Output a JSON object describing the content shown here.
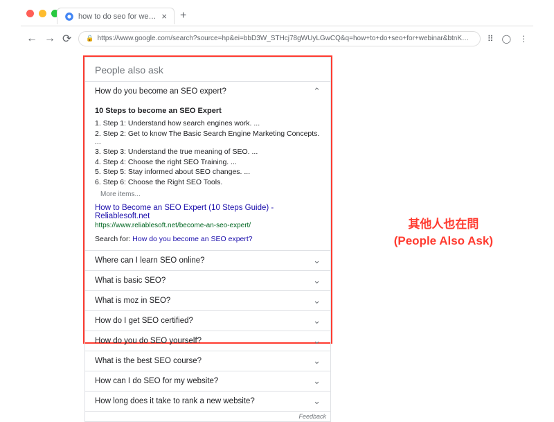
{
  "browser": {
    "tab_title": "how to do seo for webinar - Go",
    "url": "https://www.google.com/search?source=hp&ei=bbD3W_STHcj78gWUyLGwCQ&q=how+to+do+seo+for+webinar&btnK=Google+Search&oq=how+to+do+se..."
  },
  "paa": {
    "header": "People also ask",
    "expanded_question": "How do you become an SEO expert?",
    "expanded_title": "10 Steps to become an SEO Expert",
    "steps": [
      "Step 1: Understand how search engines work. ...",
      "Step 2: Get to know The Basic Search Engine Marketing Concepts. ...",
      "Step 3: Understand the true meaning of SEO. ...",
      "Step 4: Choose the right SEO Training. ...",
      "Step 5: Stay informed about SEO changes. ...",
      "Step 6: Choose the Right SEO Tools."
    ],
    "more_items": "More items...",
    "result_title": "How to Become an SEO Expert (10 Steps Guide) - Reliablesoft.net",
    "result_url": "https://www.reliablesoft.net/become-an-seo-expert/",
    "search_for_label": "Search for: ",
    "search_for_link": "How do you become an SEO expert?",
    "questions": [
      "Where can I learn SEO online?",
      "What is basic SEO?",
      "What is moz in SEO?",
      "How do I get SEO certified?",
      "How do you do SEO yourself?",
      "What is the best SEO course?",
      "How can I do SEO for my website?",
      "How long does it take to rank a new website?"
    ],
    "feedback": "Feedback"
  },
  "annotation": {
    "line1": "其他人也在問",
    "line2": "(People Also Ask)"
  }
}
